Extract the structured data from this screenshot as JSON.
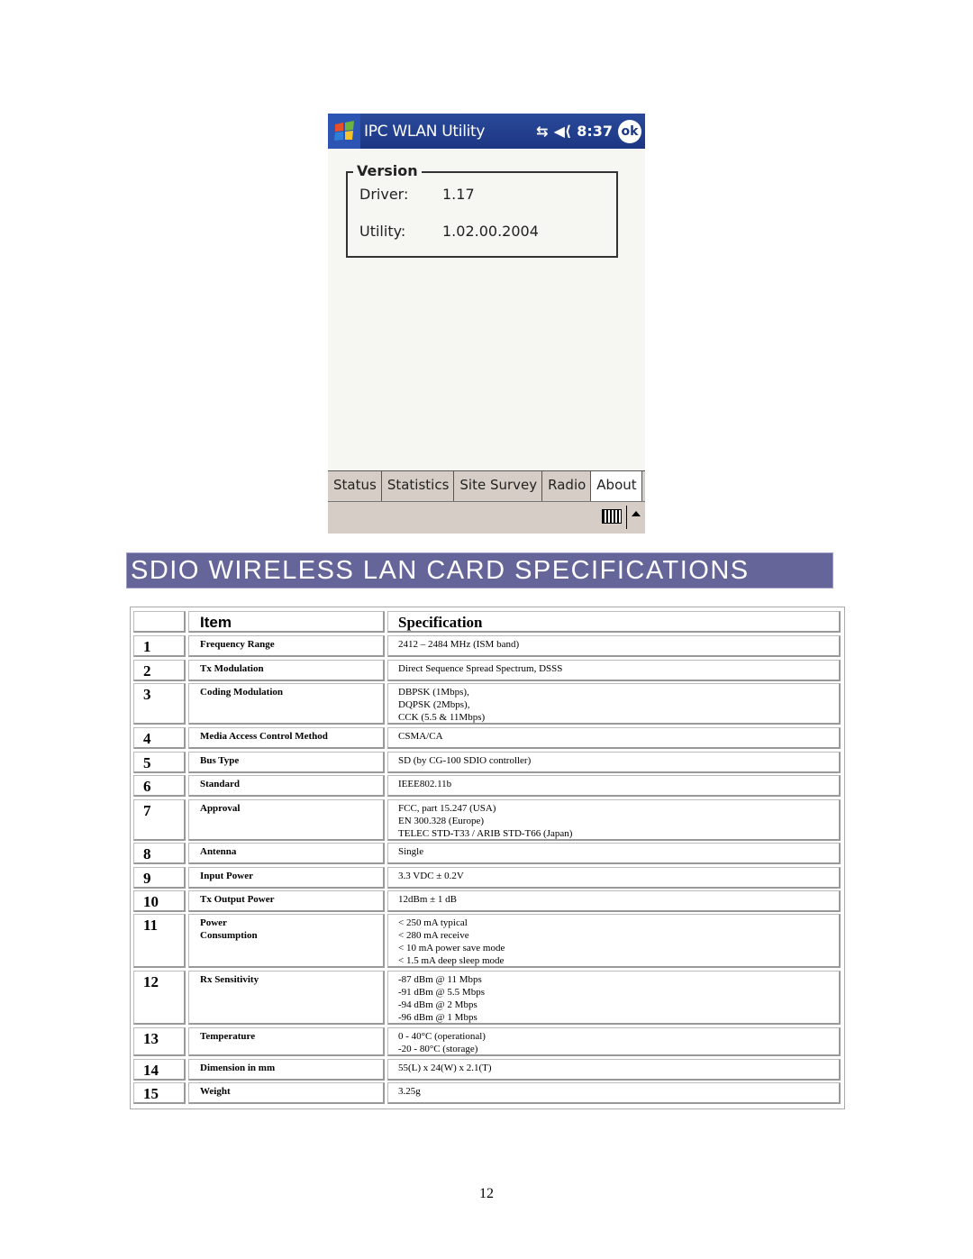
{
  "screenshot": {
    "app_title": "IPC WLAN Utility",
    "clock": "8:37",
    "ok_label": "ok",
    "icons": [
      "windows-start-icon",
      "sync-icon",
      "speaker-icon"
    ],
    "version_group": {
      "legend": "Version",
      "driver_label": "Driver:",
      "driver_value": "1.17",
      "utility_label": "Utility:",
      "utility_value": "1.02.00.2004"
    },
    "tabs": [
      {
        "label": "Status",
        "active": false
      },
      {
        "label": "Statistics",
        "active": false
      },
      {
        "label": "Site Survey",
        "active": false
      },
      {
        "label": "Radio",
        "active": false
      },
      {
        "label": "About",
        "active": true
      }
    ],
    "colors": {
      "titlebar": "#1c3683",
      "tabbar": "#d6cec6"
    }
  },
  "section": {
    "title": "SDIO WIRELESS LAN CARD SPECIFICATIONS",
    "color": "#66659a"
  },
  "table": {
    "headers": {
      "num": "",
      "item": "Item",
      "spec": "Specification"
    },
    "rows": [
      {
        "num": "1",
        "item": "Frequency Range",
        "spec": "2412 – 2484 MHz (ISM band)"
      },
      {
        "num": "2",
        "item": "Tx Modulation",
        "spec": "Direct Sequence Spread Spectrum, DSSS"
      },
      {
        "num": "3",
        "item": "Coding Modulation",
        "spec": "DBPSK (1Mbps),\nDQPSK (2Mbps),\nCCK (5.5 & 11Mbps)"
      },
      {
        "num": "4",
        "item": "Media Access Control Method",
        "spec": "CSMA/CA"
      },
      {
        "num": "5",
        "item": "Bus Type",
        "spec": "SD (by CG-100 SDIO controller)"
      },
      {
        "num": "6",
        "item": "Standard",
        "spec": "IEEE802.11b"
      },
      {
        "num": "7",
        "item": "Approval",
        "spec": "FCC, part 15.247 (USA)\nEN 300.328 (Europe)\nTELEC STD-T33 / ARIB STD-T66 (Japan)"
      },
      {
        "num": "8",
        "item": "Antenna",
        "spec": "Single"
      },
      {
        "num": "9",
        "item": "Input Power",
        "spec": "3.3 VDC ± 0.2V"
      },
      {
        "num": "10",
        "item": "Tx Output Power",
        "spec": "12dBm ± 1 dB"
      },
      {
        "num": "11",
        "item": "Power\nConsumption",
        "spec": "< 250 mA typical\n< 280 mA receive\n< 10 mA power save mode\n< 1.5 mA deep sleep mode"
      },
      {
        "num": "12",
        "item": "Rx Sensitivity",
        "spec": "-87 dBm @ 11 Mbps\n-91 dBm @ 5.5 Mbps\n-94 dBm @ 2 Mbps\n-96 dBm @ 1 Mbps"
      },
      {
        "num": "13",
        "item": "Temperature",
        "spec": "0 - 40°C (operational)\n-20 - 80°C (storage)"
      },
      {
        "num": "14",
        "item": "Dimension in mm",
        "spec": "55(L) x 24(W) x 2.1(T)"
      },
      {
        "num": "15",
        "item": "Weight",
        "spec": "3.25g"
      }
    ]
  },
  "page_number": "12"
}
